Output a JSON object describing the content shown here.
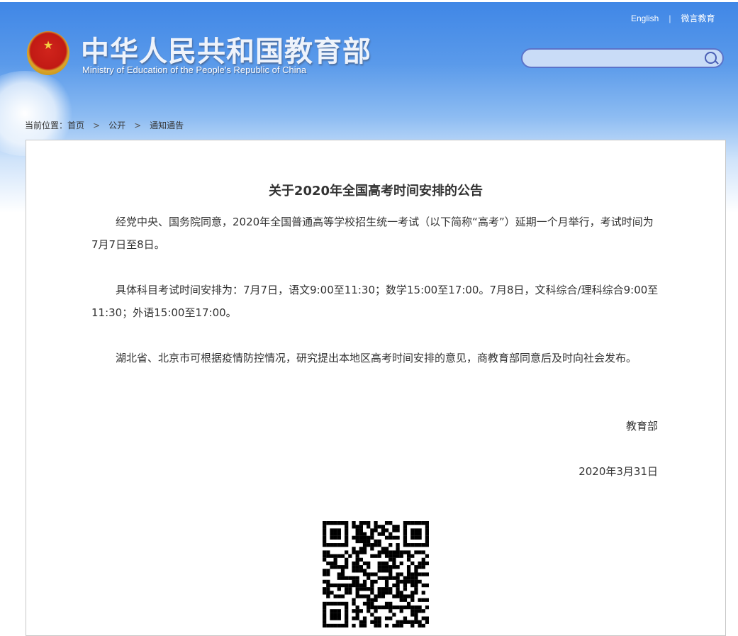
{
  "header": {
    "title_cn": "中华人民共和国教育部",
    "title_en": "Ministry of Education of the People's Republic of China",
    "links": [
      "English",
      "微言教育"
    ],
    "search": {
      "placeholder": "",
      "value": ""
    }
  },
  "breadcrumb": {
    "label": "当前位置：",
    "items": [
      "首页",
      "公开",
      "通知通告"
    ]
  },
  "article": {
    "title": "关于2020年全国高考时间安排的公告",
    "paragraphs": [
      "经党中央、国务院同意，2020年全国普通高等学校招生统一考试（以下简称“高考”）延期一个月举行，考试时间为7月7日至8日。",
      "具体科目考试时间安排为：7月7日，语文9:00至11:30；数学15:00至17:00。7月8日，文科综合/理科综合9:00至11:30；外语15:00至17:00。",
      "湖北省、北京市可根据疫情防控情况，研究提出本地区高考时间安排的意见，商教育部同意后及时向社会发布。"
    ],
    "signature": "教育部",
    "date": "2020年3月31日"
  }
}
